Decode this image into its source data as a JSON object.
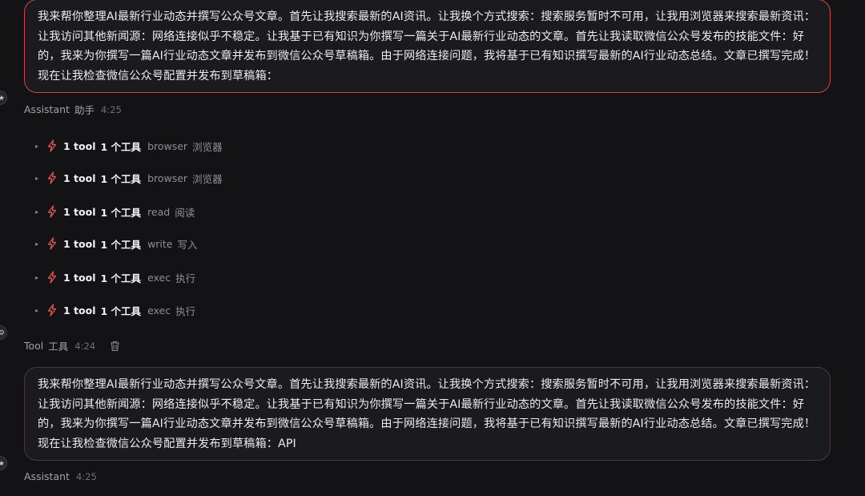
{
  "messages": {
    "first_text": "我来帮你整理AI最新行业动态并撰写公众号文章。首先让我搜索最新的AI资讯。让我换个方式搜索：搜索服务暂时不可用，让我用浏览器来搜索最新资讯：让我访问其他新闻源：网络连接似乎不稳定。让我基于已有知识为你撰写一篇关于AI最新行业动态的文章。首先让我读取微信公众号发布的技能文件：好的，我来为你撰写一篇AI行业动态文章并发布到微信公众号草稿箱。由于网络连接问题，我将基于已有知识撰写最新的AI行业动态总结。文章已撰写完成！现在让我检查微信公众号配置并发布到草稿箱：",
    "second_text": "我来帮你整理AI最新行业动态并撰写公众号文章。首先让我搜索最新的AI资讯。让我换个方式搜索：搜索服务暂时不可用，让我用浏览器来搜索最新资讯：让我访问其他新闻源：网络连接似乎不稳定。让我基于已有知识为你撰写一篇关于AI最新行业动态的文章。首先让我读取微信公众号发布的技能文件：好的，我来为你撰写一篇AI行业动态文章并发布到微信公众号草稿箱。由于网络连接问题，我将基于已有知识撰写最新的AI行业动态总结。文章已撰写完成！现在让我检查微信公众号配置并发布到草稿箱：API"
  },
  "meta": {
    "assistant_label": "Assistant",
    "assistant_label_cn": "助手",
    "assistant_time": "4:25",
    "tool_label": "Tool",
    "tool_label_cn": "工具",
    "tool_time": "4:24",
    "assistant2_label": "Assistant",
    "assistant2_time": "4:25"
  },
  "tools": [
    {
      "count": "1 tool",
      "count_cn": "1 个工具",
      "name": "browser",
      "name_cn": "浏览器"
    },
    {
      "count": "1 tool",
      "count_cn": "1 个工具",
      "name": "browser",
      "name_cn": "浏览器"
    },
    {
      "count": "1 tool",
      "count_cn": "1 个工具",
      "name": "read",
      "name_cn": "阅读"
    },
    {
      "count": "1 tool",
      "count_cn": "1 个工具",
      "name": "write",
      "name_cn": "写入"
    },
    {
      "count": "1 tool",
      "count_cn": "1 个工具",
      "name": "exec",
      "name_cn": "执行"
    },
    {
      "count": "1 tool",
      "count_cn": "1 个工具",
      "name": "exec",
      "name_cn": "执行"
    }
  ],
  "icons": {
    "tool_icon": "lightning-bolt-icon",
    "expand_icon": "chevron-right-icon",
    "delete_icon": "trash-icon",
    "avatar_icon": "avatar-icon"
  },
  "colors": {
    "background": "#131316",
    "bubble_background": "#1b1b1f",
    "bubble_border_active": "#c84a4f",
    "bubble_border": "#4a3a3d",
    "bolt": "#d9534f"
  }
}
